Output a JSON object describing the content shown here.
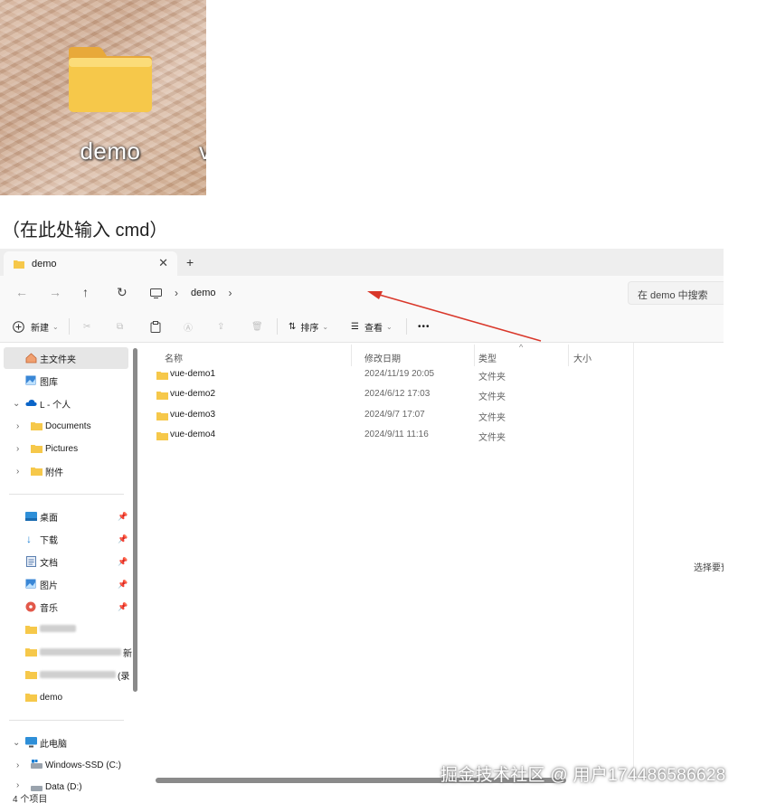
{
  "desktop": {
    "folder_label": "demo",
    "truncated_label": "v"
  },
  "instruction": "（在此处输入 cmd）",
  "window": {
    "tab": {
      "title": "demo",
      "close": "✕",
      "new_tab": "+"
    },
    "nav": {
      "back": "←",
      "forward": "→",
      "up": "↑",
      "refresh": "↻"
    },
    "breadcrumb": {
      "sep1": "›",
      "folder": "demo",
      "sep2": "›"
    },
    "search_placeholder": "在 demo 中搜索",
    "toolbar": {
      "new_label": "新建",
      "sort_label": "排序",
      "view_label": "查看",
      "more": "•••"
    },
    "sidebar": {
      "home": "主文件夹",
      "gallery": "图库",
      "onedrive": "L - 个人",
      "documents": "Documents",
      "pictures": "Pictures",
      "attachments": "附件",
      "desktop": "桌面",
      "downloads": "下载",
      "docs": "文档",
      "images": "图片",
      "music": "音乐",
      "redacted1_suffix": "",
      "redacted2_suffix": "新",
      "redacted3_suffix": "(录",
      "demo": "demo",
      "this_pc": "此电脑",
      "drive_c": "Windows-SSD (C:)",
      "drive_d": "Data (D:)"
    },
    "columns": {
      "name": "名称",
      "modified": "修改日期",
      "type": "类型",
      "size": "大小"
    },
    "files": [
      {
        "name": "vue-demo1",
        "modified": "2024/11/19 20:05",
        "type": "文件夹"
      },
      {
        "name": "vue-demo2",
        "modified": "2024/6/12 17:03",
        "type": "文件夹"
      },
      {
        "name": "vue-demo3",
        "modified": "2024/9/7 17:07",
        "type": "文件夹"
      },
      {
        "name": "vue-demo4",
        "modified": "2024/9/11 11:16",
        "type": "文件夹"
      }
    ],
    "preview_hint": "选择要预",
    "status": "4 个项目"
  },
  "watermark": "掘金技术社区 @ 用户174486586628",
  "colors": {
    "folder_yellow": "#f6c84a",
    "arrow_red": "#d9372a",
    "accent_blue": "#0067c0"
  }
}
